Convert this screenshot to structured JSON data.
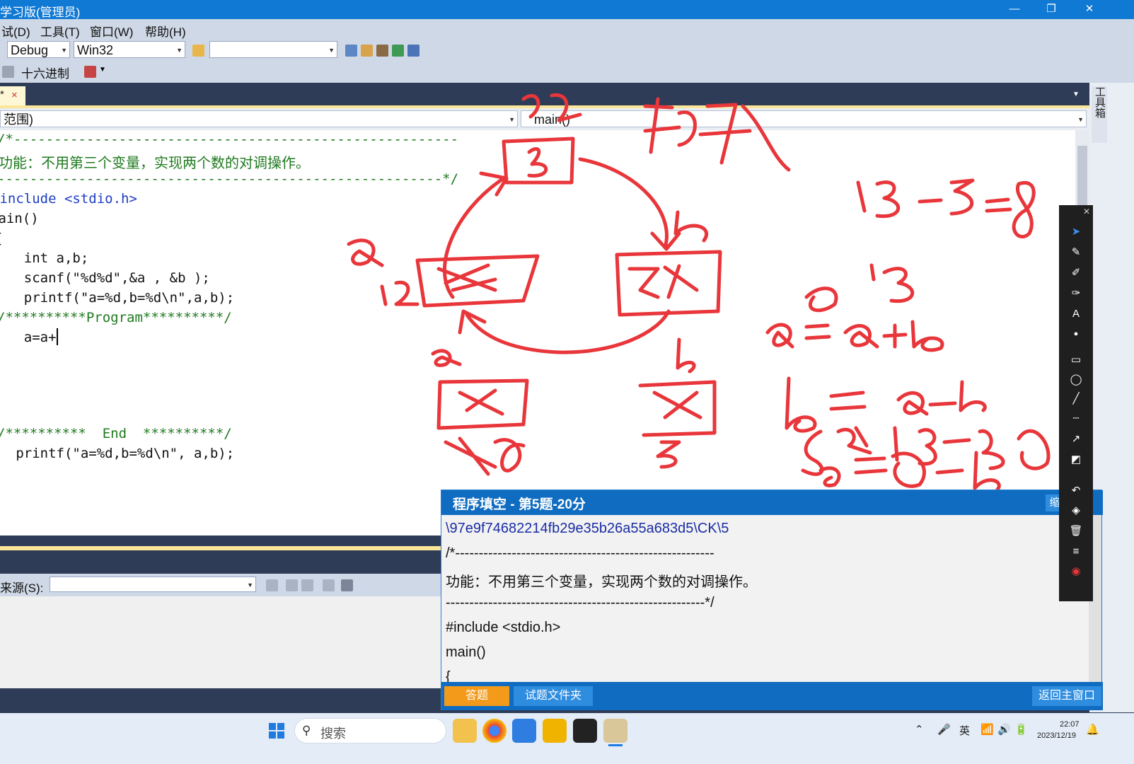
{
  "window": {
    "title": "学习版(管理员)",
    "minimize": "—",
    "restore": "❐",
    "close": "✕"
  },
  "menu": {
    "items": [
      "试(D)",
      "工具(T)",
      "窗口(W)",
      "帮助(H)"
    ]
  },
  "toolbar": {
    "config": "Debug",
    "platform": "Win32",
    "find_value": "",
    "hex_label": "十六进制"
  },
  "doc": {
    "tab_label": "*",
    "tab_close": "×",
    "scope_combo": "范围)",
    "func_combo": "main()"
  },
  "code": {
    "lines": [
      "/*-------------------------------------------------------",
      "功能：不用第三个变量，实现两个数的对调操作。",
      "-------------------------------------------------------*/",
      "#include <stdio.h>",
      "main()",
      "{",
      "    int a,b;",
      "    scanf(\"%d%d\",&a , &b );",
      "    printf(\"a=%d,b=%d\\n\",a,b);",
      "/**********Program**********/",
      "    a=a+",
      "/**********  End  **********/",
      "   printf(\"a=%d,b=%d\\n\", a,b);"
    ]
  },
  "lower_panel": {
    "source_label": "来源(S):",
    "source_value": ""
  },
  "sidebar": {
    "toolbox_label": "工具箱"
  },
  "exam": {
    "title": "程序填空 - 第5题-20分",
    "shrink_label": "缩",
    "path": "\\97e9f74682214fb29e35b26a55a683d5\\CK\\5",
    "lines": [
      "/*-------------------------------------------------------",
      "功能：不用第三个变量，实现两个数的对调操作。",
      "-------------------------------------------------------*/",
      "#include <stdio.h>",
      "main()",
      "{"
    ],
    "btn_answer": "答题",
    "btn_folder": "试题文件夹",
    "btn_return": "返回主窗口"
  },
  "taskbar": {
    "search_placeholder": "搜索",
    "ime": "英",
    "time": "22:07",
    "date": "2023/12/19"
  },
  "colors": {
    "titlebar": "#0f79d4",
    "ink": "#e8363b",
    "exam_header": "#0f6cc0"
  }
}
